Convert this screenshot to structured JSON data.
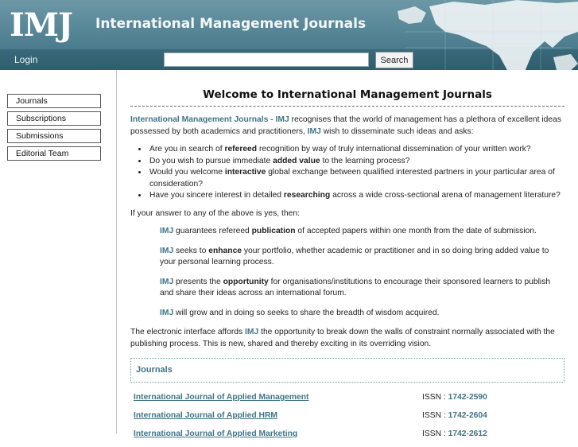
{
  "header": {
    "logo": "IMJ",
    "title": "International Management Journals",
    "login": "Login",
    "search_value": "",
    "search_button": "Search"
  },
  "sidebar": {
    "items": [
      {
        "label": "Journals"
      },
      {
        "label": "Subscriptions"
      },
      {
        "label": "Submissions"
      },
      {
        "label": "Editorial Team"
      }
    ]
  },
  "main": {
    "heading": "Welcome to International Management Journals",
    "intro": {
      "brand": "International Management Journals - IMJ",
      "text1": " recognises that the world of management has a plethora of excellent ideas possessed by both academics and practitioners, ",
      "brand2": "IMJ",
      "text2": " wish to disseminate such ideas and asks:"
    },
    "questions": [
      {
        "pre": "Are you in search of ",
        "bold": "refereed",
        "post": " recognition by way of truly international dissemination of your written work?"
      },
      {
        "pre": "Do you wish to pursue immediate ",
        "bold": "added value",
        "post": " to the learning process?"
      },
      {
        "pre": "Would you welcome ",
        "bold": "interactive",
        "post": " global exchange between qualified interested partners in your particular area of consideration?"
      },
      {
        "pre": "Have you sincere interest in detailed ",
        "bold": "researching",
        "post": " across a wide cross-sectional arena of management literature?"
      }
    ],
    "answer_intro": "If your answer to any of the above is yes, then:",
    "points": [
      {
        "brand": "IMJ",
        "pre": " guarantees refereed ",
        "bold": "publication",
        "post": " of accepted papers within one month from the date of submission."
      },
      {
        "brand": "IMJ",
        "pre": " seeks to ",
        "bold": "enhance",
        "post": " your portfolio, whether academic or practitioner and in so doing bring added value to your personal learning process."
      },
      {
        "brand": "IMJ",
        "pre": " presents the ",
        "bold": "opportunity",
        "post": " for organisations/institutions to encourage their sponsored learners to publish and share their ideas across an international forum."
      },
      {
        "brand": "IMJ",
        "pre": " will grow and in doing so seeks to share the breadth of wisdom acquired.",
        "bold": "",
        "post": ""
      }
    ],
    "closing": {
      "pre": "The electronic interface affords ",
      "brand": "IMJ",
      "post": " the opportunity to break down the walls of constraint normally associated with the publishing process. This is new, shared and thereby exciting in its overriding vision."
    },
    "journals_heading": "Journals",
    "journals": [
      {
        "name": "International Journal of Applied Management",
        "issn_label": "ISSN : ",
        "issn": "1742-2590"
      },
      {
        "name": "International Journal of Applied HRM",
        "issn_label": "ISSN : ",
        "issn": "1742-2604"
      },
      {
        "name": "International Journal of Applied Marketing",
        "issn_label": "ISSN : ",
        "issn": "1742-2612"
      }
    ]
  },
  "colors": {
    "header": "#4a7b8c",
    "accent": "#3f7487"
  }
}
